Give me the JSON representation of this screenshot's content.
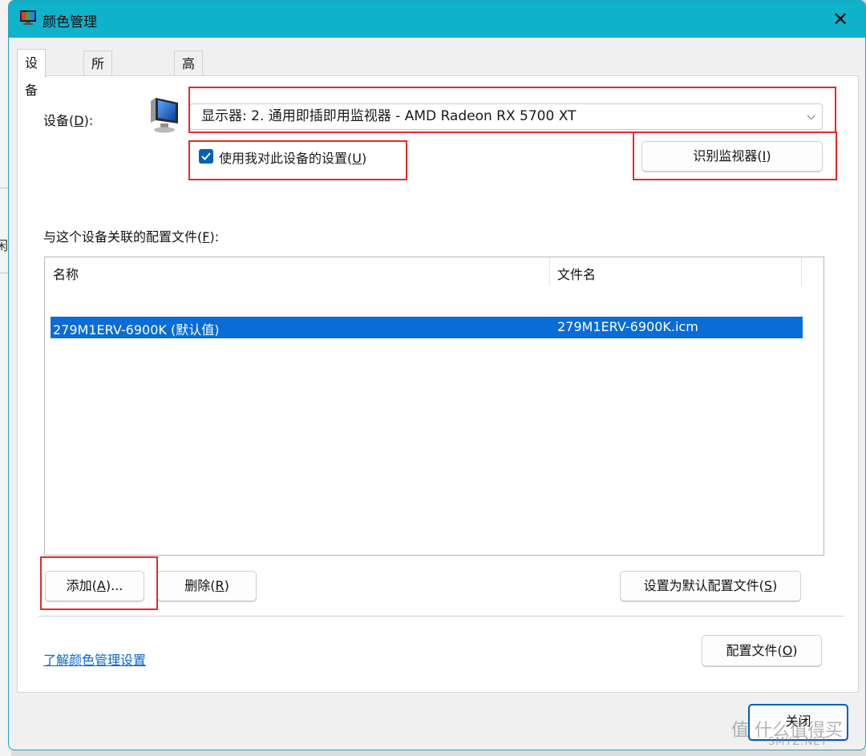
{
  "background": {
    "fragment_text": "闲"
  },
  "window": {
    "title": "颜色管理",
    "close_glyph": "✕"
  },
  "tabs": [
    {
      "label": "设备",
      "active": true
    },
    {
      "label": "所有配置文件",
      "active": false
    },
    {
      "label": "高级",
      "active": false
    }
  ],
  "device": {
    "label_prefix": "设备(",
    "label_key": "D",
    "label_suffix": "):",
    "selected": "显示器: 2. 通用即插即用监视器 - AMD Radeon RX 5700 XT",
    "chevron": "⌵"
  },
  "checkbox": {
    "label_prefix": "使用我对此设备的设置(",
    "label_key": "U",
    "label_suffix": ")",
    "checked": true
  },
  "identify_button": {
    "label_prefix": "识别监视器(",
    "label_key": "I",
    "label_suffix": ")"
  },
  "profiles_section": {
    "label_prefix": "与这个设备关联的配置文件(",
    "label_key": "F",
    "label_suffix": "):"
  },
  "list": {
    "columns": [
      "名称",
      "文件名"
    ],
    "rows": [
      {
        "name": "279M1ERV-6900K (默认值)",
        "filename": "279M1ERV-6900K.icm",
        "selected": true
      }
    ]
  },
  "buttons": {
    "add": {
      "prefix": "添加(",
      "key": "A",
      "suffix": ")..."
    },
    "remove": {
      "prefix": "删除(",
      "key": "R",
      "suffix": ")"
    },
    "set_default": {
      "prefix": "设置为默认配置文件(",
      "key": "S",
      "suffix": ")"
    },
    "profiles": {
      "prefix": "配置文件(",
      "key": "O",
      "suffix": ")"
    },
    "close": {
      "label": "关闭"
    }
  },
  "learn_link": "了解颜色管理设置",
  "watermark": {
    "main": "值 什么值得买",
    "sub": "SMYZ.NET"
  },
  "colors": {
    "titlebar": "#0fb2cb",
    "selection": "#0a6cd6",
    "annotation_red": "#e8292a",
    "checkbox_blue": "#005fb8",
    "link": "#0a64c8"
  }
}
